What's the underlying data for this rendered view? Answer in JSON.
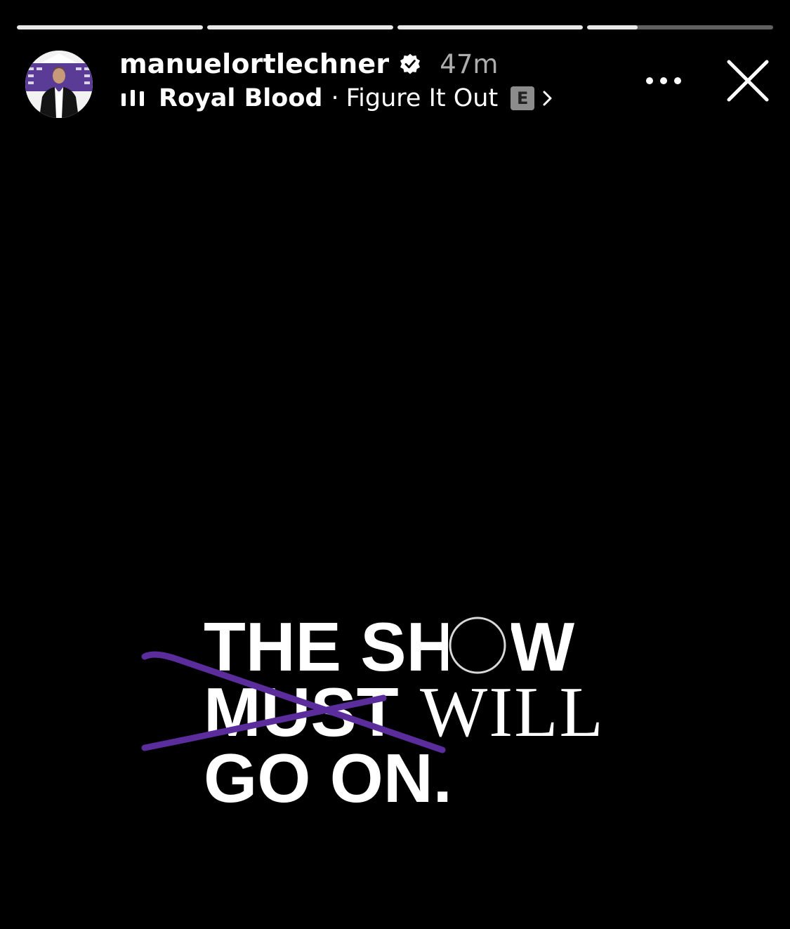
{
  "progress": {
    "segments": [
      1,
      1,
      1,
      0.27
    ]
  },
  "header": {
    "username": "manuelortlechner",
    "verified": true,
    "time": "47m"
  },
  "music": {
    "icon": "equalizer-bars-icon",
    "artist": "Royal Blood",
    "separator": "·",
    "song": "Figure It Out",
    "explicit": "E"
  },
  "controls": {
    "more": "more-options-icon",
    "close": "close-icon"
  },
  "story": {
    "line1": "THE SHOW",
    "line2_struck": "MUST",
    "line2_replacement": "WILL",
    "line3": "GO ON.",
    "accent": "#5b2d9c"
  }
}
